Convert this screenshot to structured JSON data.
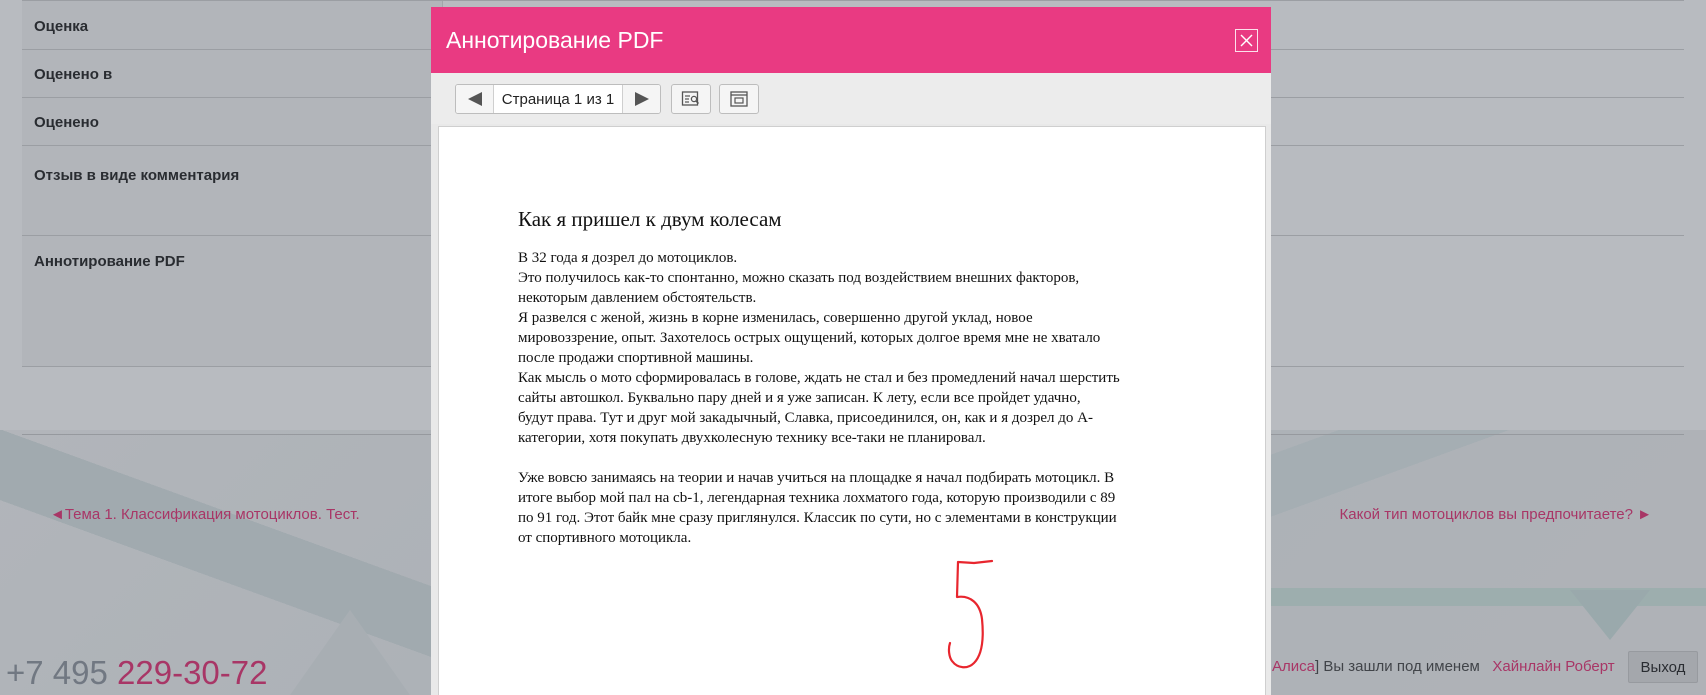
{
  "form": {
    "rows": [
      {
        "label": "Оценка"
      },
      {
        "label": "Оценено в"
      },
      {
        "label": "Оценено"
      },
      {
        "label": "Отзыв в виде комментария"
      },
      {
        "label": "Аннотирование PDF"
      }
    ]
  },
  "navigation": {
    "prev_label": "◄Тема 1. Классификация мотоциклов. Тест.",
    "next_label": "Какой тип мотоциклов вы предпочитаете? ►"
  },
  "footer": {
    "phone_code": "+7 495",
    "phone_number": "229-30-72",
    "login_prefix": "Алиса",
    "login_text": "] Вы зашли под именем",
    "user_name": "Хайнлайн Роберт",
    "logout_label": "Выход"
  },
  "modal": {
    "title": "Аннотирование PDF",
    "page_indicator": "Страница 1 из 1",
    "icons": {
      "close": "close-icon",
      "prev": "triangle-left-icon",
      "next": "triangle-right-icon",
      "search": "search-document-icon",
      "popup": "popup-window-icon"
    }
  },
  "document": {
    "title": "Как я пришел к двум колесам",
    "paragraphs": [
      [
        "В 32  года я дозрел до мотоциклов.",
        "Это получилось как-то спонтанно, можно сказать под воздействием внешних факторов,",
        "некоторым давлением обстоятельств.",
        "Я развелся с женой, жизнь в корне изменилась, совершенно другой уклад, новое",
        "мировоззрение, опыт. Захотелось острых ощущений, которых долгое время мне не хватало",
        "после продажи спортивной машины.",
        "Как мысль о мото сформировалась в голове, ждать не стал и без промедлений начал шерстить",
        "сайты автошкол. Буквально пару дней и я уже записан. К лету, если все пройдет удачно,",
        "будут права. Тут и друг мой закадычный, Славка, присоединился, он, как и я дозрел до А-",
        "категории, хотя покупать двухколесную технику все-таки не планировал."
      ],
      [
        "Уже вовсю занимаясь на теории и начав учиться на площадке я начал подбирать мотоцикл. В",
        "итоге выбор мой пал на cb-1, легендарная техника лохматого года, которую производили с 89",
        "по 91 год. Этот байк мне сразу приглянулся. Классик по сути, но с элементами в конструкции",
        "от спортивного мотоцикла."
      ]
    ],
    "annotation": {
      "ink_color": "#e8262e"
    }
  },
  "colors": {
    "brand_pink": "#e93a82",
    "link_pink": "#e8417f"
  }
}
